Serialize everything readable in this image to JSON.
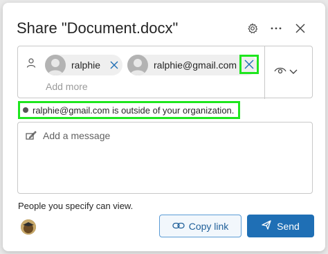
{
  "dialog": {
    "title": "Share \"Document.docx\""
  },
  "header": {
    "icons": [
      "gear-icon",
      "more-options-icon",
      "close-icon"
    ]
  },
  "recipients": [
    {
      "label": "ralphie"
    },
    {
      "label": "ralphie@gmail.com"
    }
  ],
  "people_input": {
    "placeholder": "Add more"
  },
  "warning": {
    "text": "ralphie@gmail.com is outside of your organization."
  },
  "message": {
    "placeholder": "Add a message"
  },
  "permission": {
    "note": "People you specify can view."
  },
  "buttons": {
    "copy_link": "Copy link",
    "send": "Send"
  },
  "colors": {
    "accent": "#1f6fb5",
    "highlight": "#1ee61e"
  }
}
